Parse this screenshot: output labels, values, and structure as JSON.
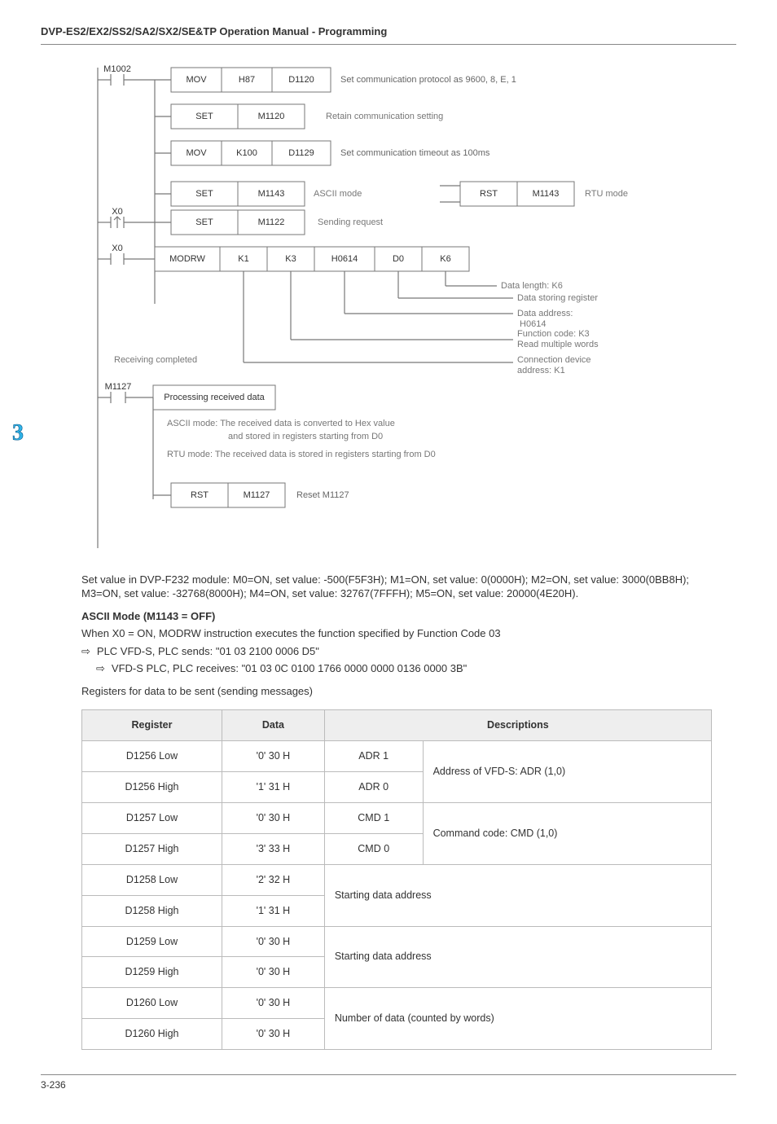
{
  "header": {
    "title": "DVP-ES2/EX2/SS2/SA2/SX2/SE&TP Operation Manual - Programming"
  },
  "side_number": "3",
  "ladder": {
    "m1002": "M1002",
    "mov": "MOV",
    "h87": "H87",
    "d1120": "D1120",
    "comm_setting": "Set communication protocol as 9600, 8, E, 1",
    "set": "SET",
    "m1120": "M1120",
    "retain": "Retain communication setting",
    "k100": "K100",
    "d1129": "D1129",
    "timeout": "Set communication timeout as 100ms",
    "m1143": "M1143",
    "ascii_mode": "ASCII ",
    "rst": "RST",
    "rtu_mode": "RTU ",
    "mode_label": "mode",
    "x0": "X0",
    "m1122": "M1122",
    "sending_req": "Sending request",
    "x0_2": "X0",
    "modrw": "MODRW",
    "k1": "K1",
    "k3": "K3",
    "h0614": "H0614",
    "d0": "D0",
    "k6": "K6",
    "data_len": "Data length: K6",
    "data_reg": "Data storing register",
    "data_addr": "Data address:",
    "data_addr2": "    H0614",
    "func_code": "Function code: K3",
    "func_code2": "Read multiple words",
    "conn_dev": "Connection device",
    "conn_dev2": "address: K1",
    "m1127": "M1127",
    "proc": "Processing received data",
    "recv_complete": "Receiving completed",
    "ascii_note": "ASCII mode: The received data is converted to Hex value",
    "ascii_note2": "and stored in registers starting from D0",
    "rtu_note": "RTU mode: The received data is stored in registers starting from D0",
    "rst2": "RST",
    "m1127_2": "M1127",
    "reset_m1127": "Reset M1127"
  },
  "narr": {
    "intro": "Set value in DVP-F232 module: M0=ON, set value: -500(F5F3H); M1=ON, set value: 0(0000H); M2=ON, set value: 3000(0BB8H); M3=ON, set value: -32768(8000H); M4=ON, set value: 32767(7FFFH); M5=ON, set value: 20000(4E20H).",
    "ascii_h": "ASCII Mode (M1143 = OFF)",
    "ascii": "When X0 = ON, MODRW instruction executes the function specified by Function Code 03",
    "bullet1": "PLC  VFD-S, PLC sends: \"01 03 2100 0006 D5\"",
    "bullet2": "VFD-S  PLC, PLC receives: \"01 03 0C 0100 1766 0000 0000 0136 0000 3B\"",
    "reg_line": "Registers for data to be sent (sending messages)"
  },
  "table": {
    "headers": [
      "Register",
      "Data",
      "Descriptions"
    ],
    "rows": [
      [
        "D1256 Low",
        "'0'  30 H",
        "ADR 1",
        "Address of VFD-S: ADR (1,0)"
      ],
      [
        "D1256 High",
        "'1'  31 H",
        "ADR 0",
        ""
      ],
      [
        "D1257 Low",
        "'0'  30 H",
        "CMD 1",
        "Command code: CMD (1,0)"
      ],
      [
        "D1257 High",
        "'3'  33 H",
        "CMD 0",
        ""
      ],
      [
        "D1258 Low",
        "'2'  32 H",
        "",
        "Starting data address"
      ],
      [
        "D1258 High",
        "'1'  31 H",
        "",
        ""
      ],
      [
        "D1259 Low",
        "'0'  30 H",
        "",
        "Starting data address"
      ],
      [
        "D1259 High",
        "'0'  30 H",
        "",
        ""
      ],
      [
        "D1260 Low",
        "'0'  30 H",
        "",
        "Number of data (counted by words)"
      ],
      [
        "D1260 High",
        "'0'  30 H",
        "",
        ""
      ]
    ]
  },
  "footer": {
    "page": "3-236"
  }
}
